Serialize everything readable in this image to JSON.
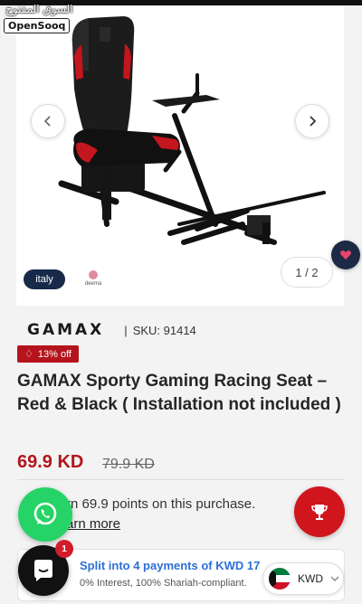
{
  "watermark": {
    "arabic": "السوق المفتوح",
    "latin": "OpenSooq"
  },
  "gallery": {
    "counter": "1 / 2",
    "badge_label": "italy",
    "partner_label": "deema"
  },
  "product": {
    "brand": "GAMAX",
    "brand_sep": "|",
    "sku": "SKU: 91414",
    "discount": "13% off",
    "title": "GAMAX Sporty Gaming Racing Seat – Red & Black ( Installation not included )",
    "price": "69.9 KD",
    "old_price": "79.9 KD"
  },
  "rewards": {
    "earn": "rn 69.9 points on this purchase.",
    "learn_more": "arn more"
  },
  "installments": {
    "title": "Split into 4 payments of KWD 17",
    "subtitle": "0% Interest, 100% Shariah-compliant."
  },
  "chat": {
    "badge_count": "1"
  },
  "currency": {
    "label": "KWD"
  },
  "colors": {
    "accent": "#b5141c",
    "link": "#2b6fd6",
    "whatsapp": "#25d366",
    "navy": "#1d2a45"
  },
  "icons": [
    "chevron-left-icon",
    "chevron-right-icon",
    "heart-icon",
    "whatsapp-icon",
    "trophy-icon",
    "chat-icon",
    "tag-icon",
    "kuwait-flag-icon",
    "chevron-down-icon"
  ]
}
